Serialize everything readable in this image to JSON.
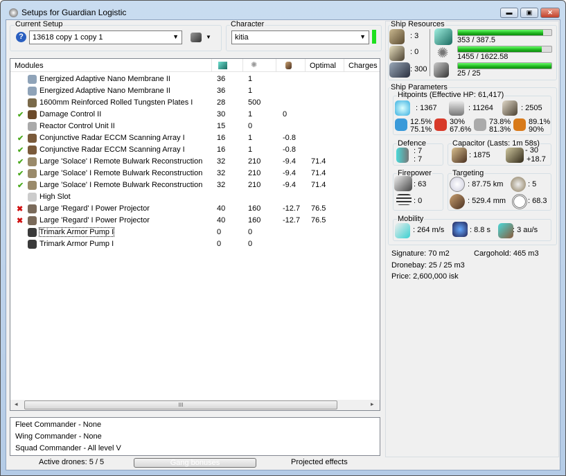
{
  "window": {
    "title": "Setups for Guardian Logistic",
    "minimize": "▬",
    "maximize": "▣",
    "close": "✕"
  },
  "setup": {
    "label": "Current Setup",
    "value": "13618 copy 1 copy 1",
    "help": "?"
  },
  "character": {
    "label": "Character",
    "value": "kitia"
  },
  "modules": {
    "headers": [
      "Modules",
      "",
      "",
      "",
      "Optimal",
      "Charges"
    ],
    "rows": [
      {
        "state": "",
        "name": "Energized Adaptive Nano Membrane II",
        "cpu": "36",
        "pg": "1",
        "cap": "",
        "optimal": "",
        "icon": "#8fa3b8"
      },
      {
        "state": "",
        "name": "Energized Adaptive Nano Membrane II",
        "cpu": "36",
        "pg": "1",
        "cap": "",
        "optimal": "",
        "icon": "#8fa3b8"
      },
      {
        "state": "",
        "name": "1600mm Reinforced Rolled Tungsten Plates I",
        "cpu": "28",
        "pg": "500",
        "cap": "",
        "optimal": "",
        "icon": "#7a6a4a"
      },
      {
        "state": "on",
        "name": "Damage Control II",
        "cpu": "30",
        "pg": "1",
        "cap": "0",
        "optimal": "",
        "icon": "#6b4a2a"
      },
      {
        "state": "",
        "name": "Reactor Control Unit II",
        "cpu": "15",
        "pg": "0",
        "cap": "",
        "optimal": "",
        "icon": "#aaa"
      },
      {
        "state": "on",
        "name": "Conjunctive Radar ECCM Scanning Array I",
        "cpu": "16",
        "pg": "1",
        "cap": "-0.8",
        "optimal": "",
        "icon": "#7a5a3a"
      },
      {
        "state": "on",
        "name": "Conjunctive Radar ECCM Scanning Array I",
        "cpu": "16",
        "pg": "1",
        "cap": "-0.8",
        "optimal": "",
        "icon": "#7a5a3a"
      },
      {
        "state": "on",
        "name": "Large 'Solace' I Remote Bulwark Reconstruction",
        "cpu": "32",
        "pg": "210",
        "cap": "-9.4",
        "optimal": "71.4",
        "icon": "#9a8a6a"
      },
      {
        "state": "on",
        "name": "Large 'Solace' I Remote Bulwark Reconstruction",
        "cpu": "32",
        "pg": "210",
        "cap": "-9.4",
        "optimal": "71.4",
        "icon": "#9a8a6a"
      },
      {
        "state": "on",
        "name": "Large 'Solace' I Remote Bulwark Reconstruction",
        "cpu": "32",
        "pg": "210",
        "cap": "-9.4",
        "optimal": "71.4",
        "icon": "#9a8a6a"
      },
      {
        "state": "",
        "name": "High Slot",
        "cpu": "",
        "pg": "",
        "cap": "",
        "optimal": "",
        "icon": "#ccc"
      },
      {
        "state": "off",
        "name": "Large 'Regard' I Power Projector",
        "cpu": "40",
        "pg": "160",
        "cap": "-12.7",
        "optimal": "76.5",
        "icon": "#7a6a5a"
      },
      {
        "state": "off",
        "name": "Large 'Regard' I Power Projector",
        "cpu": "40",
        "pg": "160",
        "cap": "-12.7",
        "optimal": "76.5",
        "icon": "#7a6a5a"
      },
      {
        "state": "",
        "name": "Trimark Armor Pump I",
        "cpu": "0",
        "pg": "0",
        "cap": "",
        "optimal": "",
        "icon": "#3a3a3a"
      },
      {
        "state": "",
        "name": "Trimark Armor Pump I",
        "cpu": "0",
        "pg": "0",
        "cap": "",
        "optimal": "",
        "icon": "#3a3a3a"
      }
    ],
    "check": "✔",
    "cross": "✖"
  },
  "scroll": {
    "grip": "III",
    "left": "◂",
    "right": "▸"
  },
  "gang": [
    "Fleet Commander - None",
    "Wing Commander - None",
    "Squad Commander - All level V"
  ],
  "status": {
    "drones": "Active drones: 5 / 5",
    "gang_button": "Gang bonuses",
    "projected": "Projected effects"
  },
  "resources": {
    "label": "Ship Resources",
    "turrets": ": 3",
    "launchers": ": 0",
    "calibration": ": 300",
    "cpu": {
      "text": "353 / 387.5",
      "fraction": 0.911
    },
    "pg": {
      "text": "1455 / 1622.58",
      "fraction": 0.897
    },
    "drone_bw": {
      "text": "25 / 25",
      "fraction": 1.0
    }
  },
  "params": {
    "label": "Ship Parameters",
    "hp_label": "Hitpoints (Effective HP: 61,417)",
    "shield": ": 1367",
    "armor": ": 11264",
    "structure": ": 2505",
    "resists": [
      {
        "a": "12.5%",
        "b": "75.1%",
        "color": "#3a9ad9"
      },
      {
        "a": "30%",
        "b": "67.6%",
        "color": "#d83a2a"
      },
      {
        "a": "73.8%",
        "b": "81.3%",
        "color": "#aaa"
      },
      {
        "a": "89.1%",
        "b": "90%",
        "color": "#d87a1a"
      }
    ],
    "defence_label": "Defence",
    "def1": ": 7",
    "def2": ": 7",
    "cap_label": "Capacitor (Lasts: 1m 58s)",
    "cap": ": 1875",
    "cap_use": "- 30",
    "cap_regen": "+18.7",
    "fire_label": "Firepower",
    "dps": ": 63",
    "volley": ": 0",
    "target_label": "Targeting",
    "range": ": 87.75 km",
    "targets": ": 5",
    "scanres": ": 529.4 mm",
    "sensor": ": 68.3",
    "mob_label": "Mobility",
    "speed": ": 264 m/s",
    "align": ": 8.8 s",
    "warp": ": 3 au/s",
    "signature": "Signature: 70 m2",
    "cargo": "Cargohold: 465 m3",
    "dronebay": "Dronebay: 25 / 25 m3",
    "price": "Price: 2,600,000 isk"
  }
}
